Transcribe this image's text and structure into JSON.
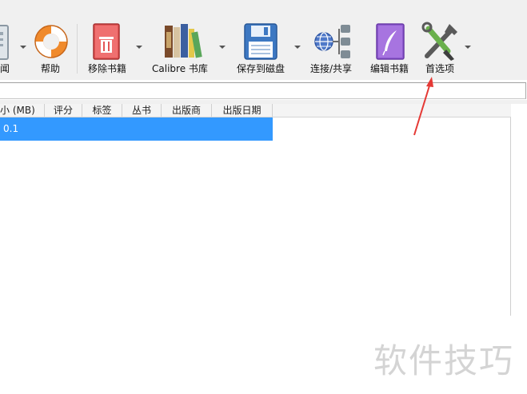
{
  "toolbar": {
    "items": [
      {
        "label": "闻",
        "icon": "news-icon"
      },
      {
        "label": "帮助",
        "icon": "help-lifebuoy-icon"
      },
      {
        "label": "移除书籍",
        "icon": "remove-books-icon"
      },
      {
        "label": "Calibre 书库",
        "icon": "library-books-icon"
      },
      {
        "label": "保存到磁盘",
        "icon": "save-disk-icon"
      },
      {
        "label": "连接/共享",
        "icon": "connect-share-icon"
      },
      {
        "label": "编辑书籍",
        "icon": "edit-book-icon"
      },
      {
        "label": "首选项",
        "icon": "preferences-tools-icon"
      }
    ]
  },
  "table": {
    "columns": [
      "小 (MB)",
      "评分",
      "标签",
      "丛书",
      "出版商",
      "出版日期"
    ],
    "rows": [
      {
        "size": "0.1"
      }
    ]
  },
  "watermark": "软件技巧",
  "colors": {
    "selection": "#3399ff",
    "annotation_arrow": "#e53935"
  }
}
